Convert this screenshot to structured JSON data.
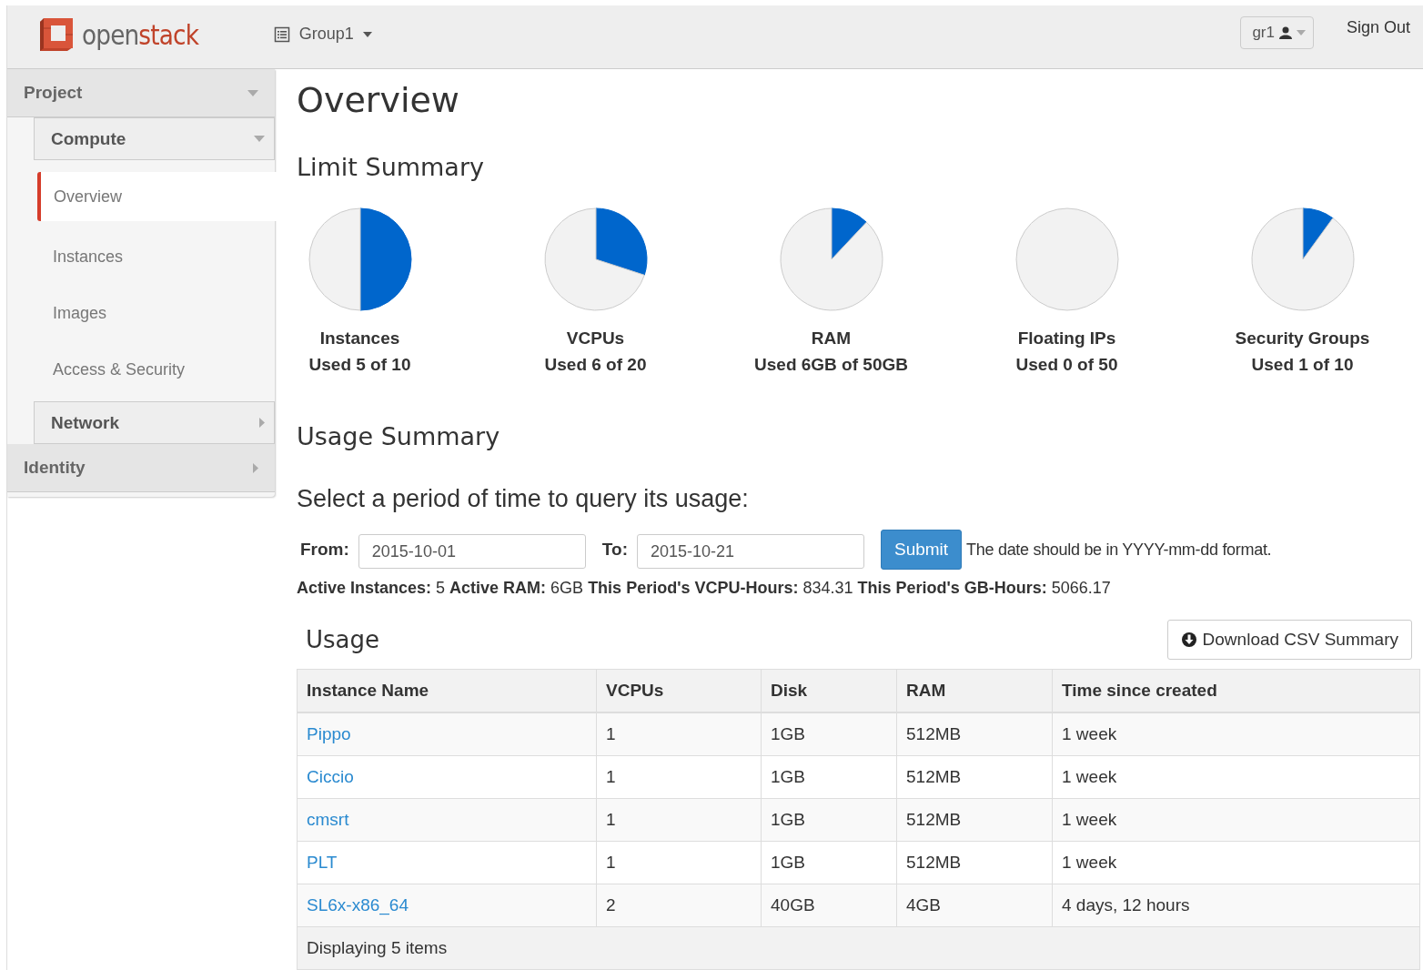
{
  "header": {
    "logo": {
      "part_1": "open",
      "part_2": "stack"
    },
    "project_menu": "Group1",
    "user_menu": "gr1",
    "sign_out": "Sign Out"
  },
  "sidebar": {
    "items": [
      {
        "label": "Project",
        "expanded": true,
        "children": [
          {
            "label": "Compute",
            "expanded": true,
            "children": [
              {
                "label": "Overview",
                "selected": true
              },
              {
                "label": "Instances",
                "selected": false
              },
              {
                "label": "Images",
                "selected": false
              },
              {
                "label": "Access & Security",
                "selected": false
              }
            ]
          },
          {
            "label": "Network",
            "expanded": false
          }
        ]
      },
      {
        "label": "Identity",
        "expanded": false
      }
    ]
  },
  "page_title": "Overview",
  "limit_summary": {
    "title": "Limit Summary",
    "charts": [
      {
        "name": "Instances",
        "usage": "Used 5 of 10",
        "chart_data": {
          "type": "pie",
          "values": [
            50,
            50
          ]
        }
      },
      {
        "name": "VCPUs",
        "usage": "Used 6 of 20",
        "chart_data": {
          "type": "pie",
          "values": [
            30,
            70
          ]
        }
      },
      {
        "name": "RAM",
        "usage": "Used 6GB of 50GB",
        "chart_data": {
          "type": "pie",
          "values": [
            12,
            88
          ]
        }
      },
      {
        "name": "Floating IPs",
        "usage": "Used 0 of 50",
        "chart_data": {
          "type": "pie",
          "values": [
            0,
            100
          ]
        }
      },
      {
        "name": "Security Groups",
        "usage": "Used 1 of 10",
        "chart_data": {
          "type": "pie",
          "values": [
            10,
            90
          ]
        }
      }
    ]
  },
  "usage_summary": {
    "title": "Usage Summary",
    "prompt": "Select a period of time to query its usage:",
    "from_label": "From:",
    "from_value": "2015-10-01",
    "to_label": "To:",
    "to_value": "2015-10-21",
    "submit": "Submit",
    "hint": "The date should be in YYYY-mm-dd format.",
    "stats": "**Active Instances:** 5 **Active RAM:** 6GB **This Period's VCPU-Hours:** 834.31 **This Period's GB-Hours:** 5066.17"
  },
  "usage": {
    "title": "Usage",
    "download": "Download CSV Summary",
    "columns": [
      "Instance Name",
      "VCPUs",
      "Disk",
      "RAM",
      "Time since created"
    ],
    "rows": [
      [
        "Pippo",
        "1",
        "1GB",
        "512MB",
        "1 week"
      ],
      [
        "Ciccio",
        "1",
        "1GB",
        "512MB",
        "1 week"
      ],
      [
        "cmsrt",
        "1",
        "1GB",
        "512MB",
        "1 week"
      ],
      [
        "PLT",
        "1",
        "1GB",
        "512MB",
        "1 week"
      ],
      [
        "SL6x-x86_64",
        "2",
        "40GB",
        "4GB",
        "4 days, 12 hours"
      ]
    ],
    "footer": "Displaying 5 items"
  }
}
